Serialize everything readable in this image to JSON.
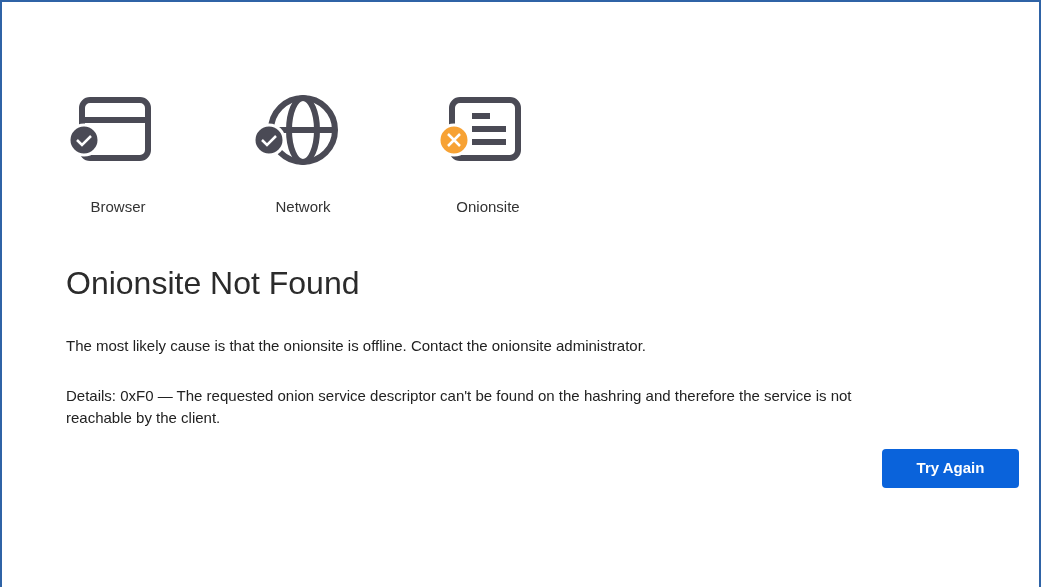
{
  "steps": [
    {
      "kind": "browser",
      "label": "Browser",
      "failed": false
    },
    {
      "kind": "network",
      "label": "Network",
      "failed": false
    },
    {
      "kind": "onionsite",
      "label": "Onionsite",
      "failed": true
    }
  ],
  "title": "Onionsite Not Found",
  "message": "The most likely cause is that the onionsite is offline. Contact the onionsite administrator.",
  "details": "Details: 0xF0 — The requested onion service descriptor can't be found on the hashring and therefore the service is not reachable by the client.",
  "button": "Try Again"
}
